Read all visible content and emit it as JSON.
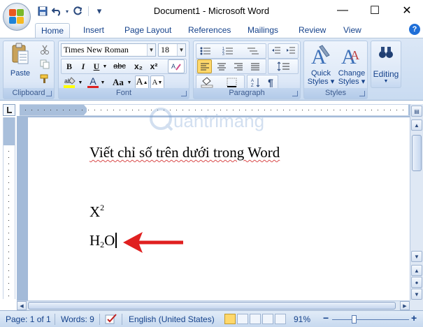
{
  "titlebar": {
    "title": "Document1 - Microsoft Word",
    "minimize": "—",
    "maximize": "☐",
    "close": "✕",
    "qat_customize": "▾"
  },
  "tabs": [
    "Home",
    "Insert",
    "Page Layout",
    "References",
    "Mailings",
    "Review",
    "View"
  ],
  "ribbon": {
    "clipboard": {
      "label": "Clipboard",
      "paste": "Paste"
    },
    "font": {
      "label": "Font",
      "font_name": "Times New Roman",
      "font_size": "18",
      "bold": "B",
      "italic": "I",
      "underline": "U",
      "strikethrough": "abc",
      "subscript": "x₂",
      "superscript": "x²",
      "grow": "A",
      "shrink": "A",
      "change_case": "Aa",
      "font_color": "A",
      "highlight": "ab"
    },
    "paragraph": {
      "label": "Paragraph",
      "pilcrow": "¶"
    },
    "styles": {
      "label": "Styles",
      "quick_styles": "Quick Styles ▾",
      "change_styles": "Change Styles ▾"
    },
    "editing": {
      "label": "Editing"
    }
  },
  "document": {
    "heading": "Viết chỉ số trên dưới trong Word",
    "line2_base": "X",
    "line2_sup": "2",
    "line3_base_a": "H",
    "line3_sub": "2",
    "line3_base_b": "O"
  },
  "statusbar": {
    "page": "Page: 1 of 1",
    "words": "Words: 9",
    "language": "English (United States)",
    "zoom": "91%",
    "zoom_minus": "−",
    "zoom_plus": "+"
  },
  "watermark": "uantrimang",
  "colors": {
    "accent": "#15428b",
    "ribbon_bg": "#dbe7f6",
    "arrow": "#e02020"
  }
}
